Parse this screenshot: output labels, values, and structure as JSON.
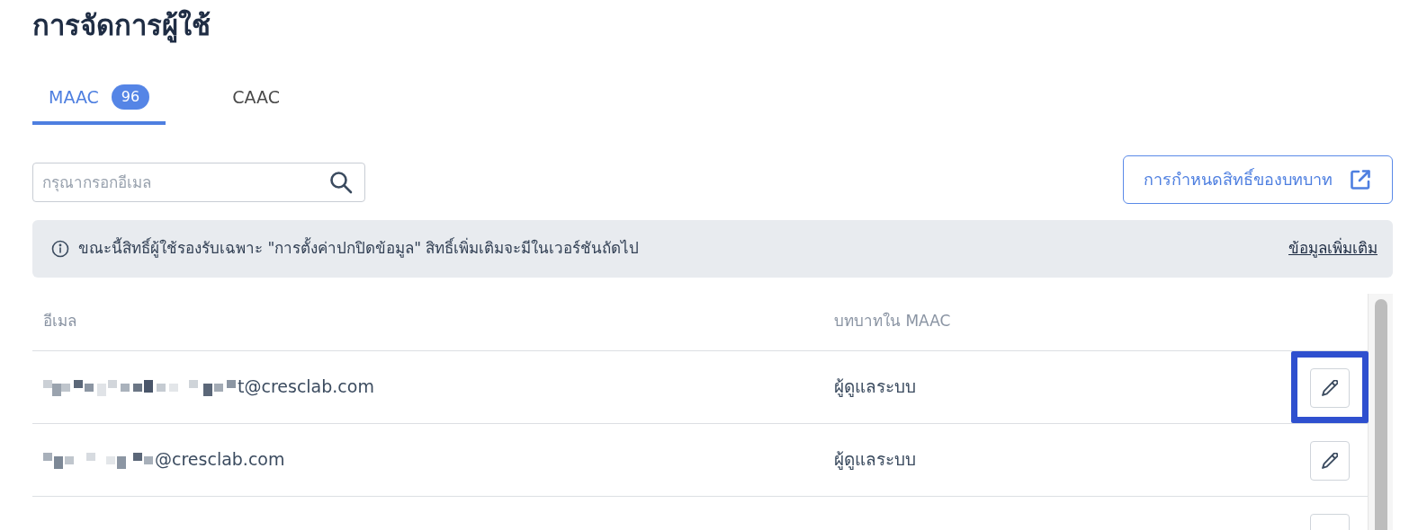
{
  "page_title": "การจัดการผู้ใช้",
  "tabs": [
    {
      "label": "MAAC",
      "badge": "96",
      "selected": true
    },
    {
      "label": "CAAC",
      "selected": false
    }
  ],
  "search": {
    "placeholder": "กรุณากรอกอีเมล"
  },
  "role_permissions_button": "การกำหนดสิทธิ์ของบทบาท",
  "notice": {
    "text": "ขณะนี้สิทธิ์ผู้ใช้รองรับเฉพาะ \"การตั้งค่าปกปิดข้อมูล\" สิทธิ์เพิ่มเติมจะมีในเวอร์ชันถัดไป",
    "link": "ข้อมูลเพิ่มเติม"
  },
  "table": {
    "columns": [
      "อีเมล",
      "บทบาทใน MAAC"
    ],
    "rows": [
      {
        "email": "t@cresclab.com",
        "role": "ผู้ดูแลระบบ",
        "redacted_prefix": true,
        "highlighted": true
      },
      {
        "email": "@cresclab.com",
        "role": "ผู้ดูแลระบบ",
        "redacted_prefix": true,
        "highlighted": false
      },
      {
        "redacted_prefix": false,
        "highlighted": false
      }
    ]
  }
}
